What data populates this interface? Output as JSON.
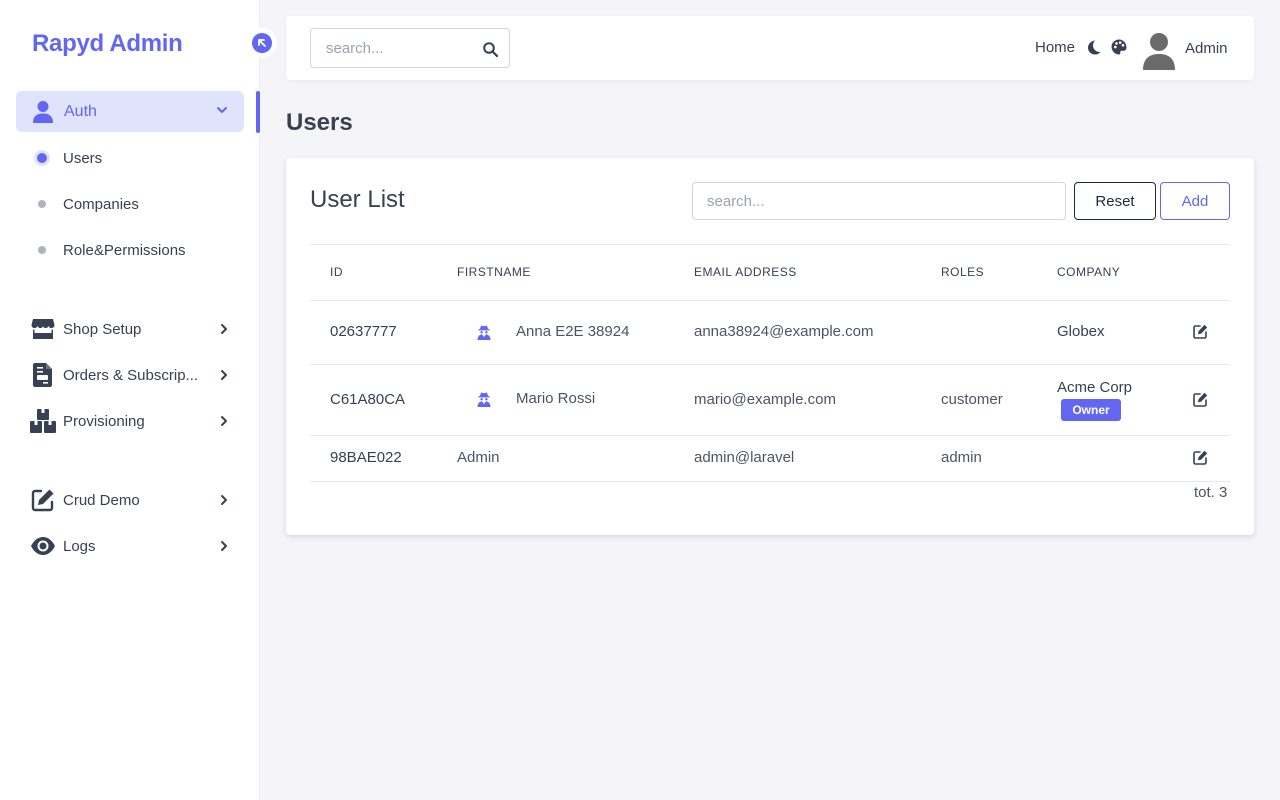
{
  "app": {
    "brand": "Rapyd Admin"
  },
  "sidebar": {
    "auth_group": {
      "label": "Auth",
      "icon": "user-icon"
    },
    "auth_items": [
      {
        "label": "Users",
        "active": true
      },
      {
        "label": "Companies",
        "active": false
      },
      {
        "label": "Role&Permissions",
        "active": false
      }
    ],
    "items": [
      {
        "label": "Shop Setup",
        "icon": "store-icon"
      },
      {
        "label": "Orders & Subscrip...",
        "icon": "document-icon"
      },
      {
        "label": "Provisioning",
        "icon": "boxes-icon"
      },
      {
        "label": "Crud Demo",
        "icon": "edit-icon"
      },
      {
        "label": "Logs",
        "icon": "eye-icon"
      }
    ]
  },
  "topbar": {
    "search_placeholder": "search...",
    "home_label": "Home",
    "user_name": "Admin"
  },
  "page": {
    "title": "Users"
  },
  "user_list": {
    "title": "User List",
    "search_placeholder": "search...",
    "reset_label": "Reset",
    "add_label": "Add",
    "columns": [
      "ID",
      "FIRSTNAME",
      "EMAIL ADDRESS",
      "ROLES",
      "COMPANY"
    ],
    "rows": [
      {
        "id": "02637777",
        "firstname": "Anna E2E 38924",
        "impersonate_icon": true,
        "email": "anna38924@example.com",
        "roles": "",
        "company": "Globex",
        "badge": ""
      },
      {
        "id": "C61A80CA",
        "firstname": "Mario Rossi",
        "impersonate_icon": true,
        "email": "mario@example.com",
        "roles": "customer",
        "company": "Acme Corp",
        "badge": "Owner"
      },
      {
        "id": "98BAE022",
        "firstname": "Admin",
        "impersonate_icon": false,
        "email": "admin@laravel",
        "roles": "admin",
        "company": "",
        "badge": ""
      }
    ],
    "total": "tot. 3"
  },
  "colors": {
    "accent": "#6366f1",
    "accent_light": "#e0e3fc",
    "text": "#374151",
    "background": "#f4f4f9"
  }
}
